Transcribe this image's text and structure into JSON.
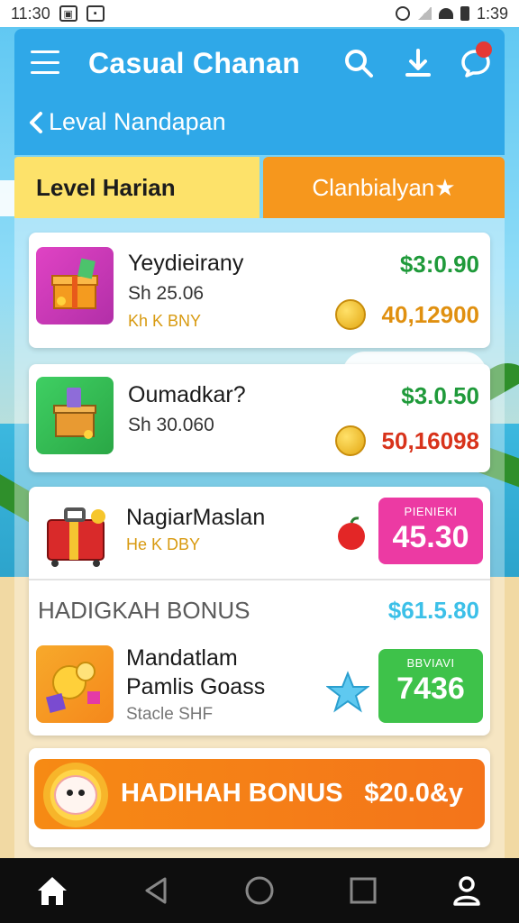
{
  "status_bar": {
    "time_left": "11:30",
    "time_right": "1:39"
  },
  "app_bar": {
    "title": "Casual Chanan",
    "back_label": "Leval Nandapan",
    "notification_count": ""
  },
  "tabs": [
    {
      "label": "Level Harian",
      "active": true
    },
    {
      "label": "Clanbialyan★",
      "active": false
    }
  ],
  "items": [
    {
      "name": "Yeydieirany",
      "sub": "Sh 25.06",
      "tag": "Kh K BNY",
      "price": "$3:0.90",
      "coins": "40,12900",
      "coins_color": "#e09010",
      "icon": "gift-box-icon"
    },
    {
      "name": "Oumadkar?",
      "sub": "Sh 30.060",
      "tag": "",
      "price": "$3.0.50",
      "coins": "50,16098",
      "coins_color": "#d8331b",
      "icon": "gift-box-icon"
    }
  ],
  "featured": {
    "name": "NagiarMaslan",
    "tag": "He K DBY",
    "price_small": "PIENIEKI",
    "price_big": "45.30",
    "price_color": "#ec3aa3",
    "icon": "suitcase-icon"
  },
  "bonus_section": {
    "title": "HADIGKAH BONUS",
    "price": "$61.5.80",
    "item_name_1": "Mandatlam",
    "item_name_2": "Pamlis Goass",
    "item_tag": "Stacle SHF",
    "price_small": "BBVIAVI",
    "price_big": "7436",
    "price_color": "#3ec24a",
    "icon": "coin-pile-icon"
  },
  "bonus_bar": {
    "label": "HADIHAH BONUS",
    "amount": "$20.0&y"
  },
  "colors": {
    "app_bar": "#2fa8e8",
    "tab_active": "#fde26a",
    "tab_other": "#f6971d",
    "green": "#1f9a3a"
  }
}
